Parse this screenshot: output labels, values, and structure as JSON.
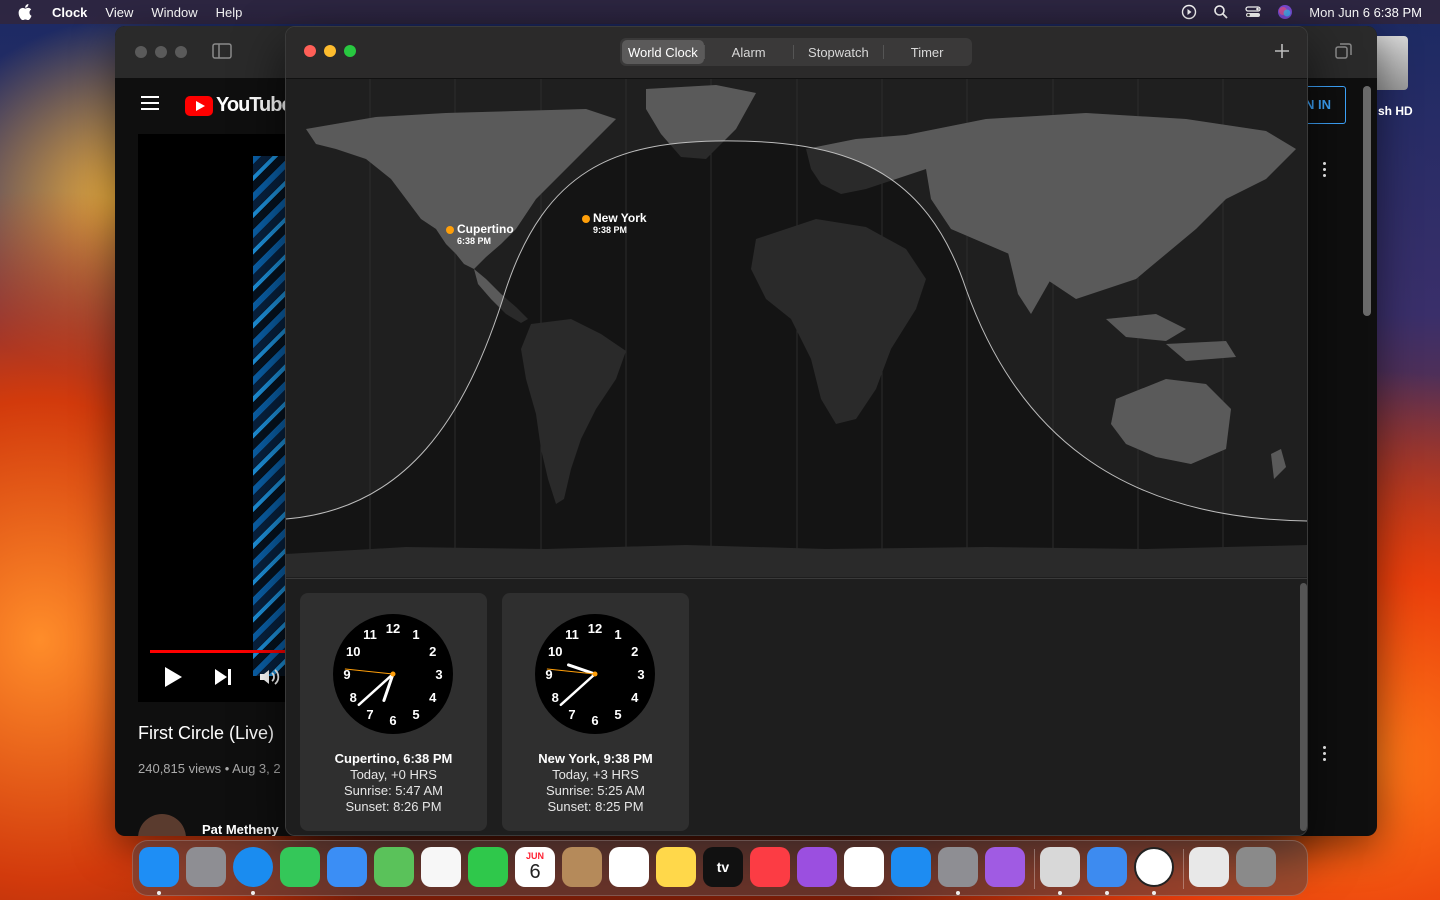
{
  "menubar": {
    "items": [
      "Clock",
      "View",
      "Window",
      "Help"
    ],
    "datetime": "Mon Jun 6  6:38 PM",
    "status_icons": [
      "play-circle-icon",
      "search-icon",
      "control-center-icon",
      "siri-icon"
    ]
  },
  "browser": {
    "site": "YouTube",
    "signin_text": "N IN",
    "video_title": "First Circle (Live)",
    "video_meta": "240,815 views • Aug 3, 2",
    "channel": "Pat Metheny",
    "desktop_disk": "sh HD"
  },
  "clock": {
    "tabs": [
      {
        "label": "World Clock",
        "active": true
      },
      {
        "label": "Alarm",
        "active": false
      },
      {
        "label": "Stopwatch",
        "active": false
      },
      {
        "label": "Timer",
        "active": false
      }
    ],
    "add_icon": "plus-icon",
    "map_cities": [
      {
        "name": "Cupertino",
        "time": "6:38 PM"
      },
      {
        "name": "New York",
        "time": "9:38 PM"
      }
    ],
    "cards": [
      {
        "title": "Cupertino, 6:38 PM",
        "offset": "Today, +0 HRS",
        "sunrise": "Sunrise: 5:47 AM",
        "sunset": "Sunset: 8:26 PM",
        "hour": 6,
        "minute": 38,
        "second": 46
      },
      {
        "title": "New York, 9:38 PM",
        "offset": "Today, +3 HRS",
        "sunrise": "Sunrise: 5:25 AM",
        "sunset": "Sunset: 8:25 PM",
        "hour": 9,
        "minute": 38,
        "second": 46
      }
    ],
    "accent_color": "#ff9f0a"
  },
  "dock": {
    "apps": [
      {
        "name": "Finder",
        "icon": "finder-icon",
        "color": "#1e8ef5",
        "running": true
      },
      {
        "name": "Launchpad",
        "icon": "launchpad-icon",
        "color": "#8e8e93",
        "running": false
      },
      {
        "name": "Safari",
        "icon": "safari-icon",
        "color": "#1a8cf0",
        "running": true
      },
      {
        "name": "Messages",
        "icon": "messages-icon",
        "color": "#34c759",
        "running": false
      },
      {
        "name": "Mail",
        "icon": "mail-icon",
        "color": "#3b8ef5",
        "running": false
      },
      {
        "name": "Maps",
        "icon": "maps-icon",
        "color": "#5ac25a",
        "running": false
      },
      {
        "name": "Photos",
        "icon": "photos-icon",
        "color": "#f7f7f7",
        "running": false
      },
      {
        "name": "FaceTime",
        "icon": "facetime-icon",
        "color": "#2fc84b",
        "running": false
      },
      {
        "name": "Calendar",
        "icon": "calendar-icon",
        "color": "#ffffff",
        "running": false
      },
      {
        "name": "Contacts",
        "icon": "contacts-icon",
        "color": "#b58a5a",
        "running": false
      },
      {
        "name": "Reminders",
        "icon": "reminders-icon",
        "color": "#ffffff",
        "running": false
      },
      {
        "name": "Notes",
        "icon": "notes-icon",
        "color": "#ffd84a",
        "running": false
      },
      {
        "name": "TV",
        "icon": "tv-icon",
        "color": "#111111",
        "running": false
      },
      {
        "name": "Music",
        "icon": "music-icon",
        "color": "#fc3c44",
        "running": false
      },
      {
        "name": "Podcasts",
        "icon": "podcasts-icon",
        "color": "#9b4fe0",
        "running": false
      },
      {
        "name": "News",
        "icon": "news-icon",
        "color": "#ffffff",
        "running": false
      },
      {
        "name": "App Store",
        "icon": "app-store-icon",
        "color": "#1d8cf2",
        "running": false
      },
      {
        "name": "System Settings",
        "icon": "system-settings-icon",
        "color": "#8e8e93",
        "running": true
      },
      {
        "name": "Feedback Assistant",
        "icon": "feedback-icon",
        "color": "#a05be3",
        "running": false
      },
      {
        "name": "Scanner",
        "icon": "scanner-icon",
        "color": "#d8d8d8",
        "running": true
      },
      {
        "name": "Weather",
        "icon": "weather-icon",
        "color": "#3d8bf0",
        "running": true
      },
      {
        "name": "Clock",
        "icon": "clock-icon",
        "color": "#ffffff",
        "running": true
      },
      {
        "name": "Document",
        "icon": "document-icon",
        "color": "#e8e8e8",
        "running": false
      },
      {
        "name": "Trash",
        "icon": "trash-icon",
        "color": "#8a8a8a",
        "running": false
      }
    ],
    "calendar_month": "JUN",
    "calendar_day": "6",
    "tv_label": "tv"
  }
}
